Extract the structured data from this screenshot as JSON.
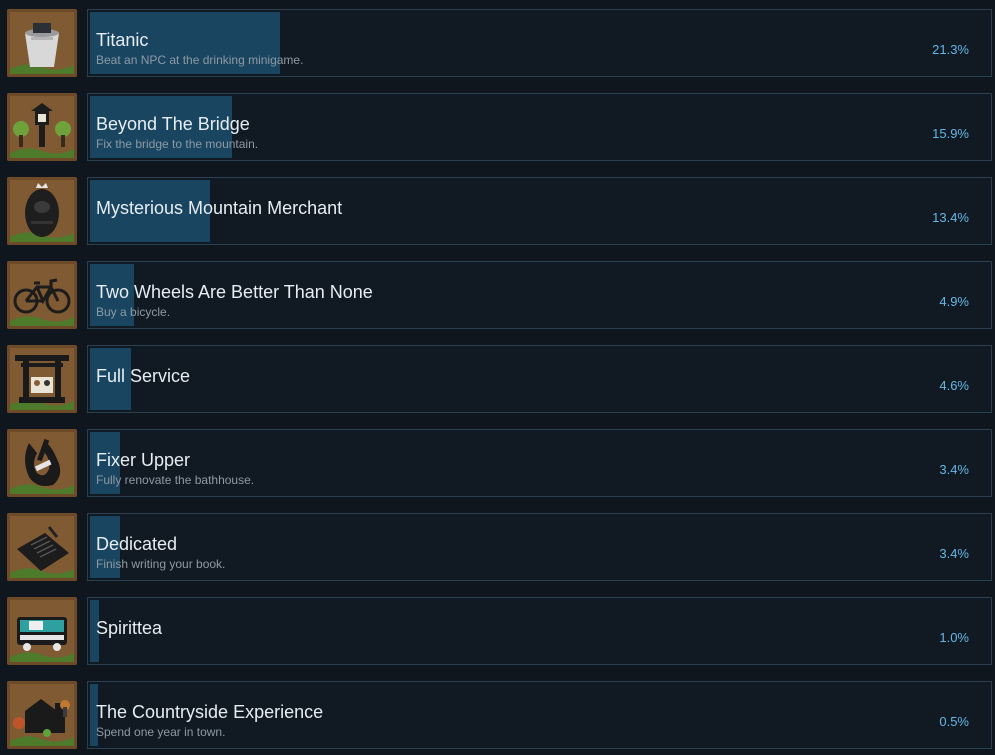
{
  "achievements": [
    {
      "title": "Titanic",
      "description": "Beat an NPC at the drinking minigame.",
      "percent_label": "21.3%",
      "percent": 21.3,
      "icon": "bucket-icon"
    },
    {
      "title": "Beyond The Bridge",
      "description": "Fix the bridge to the mountain.",
      "percent_label": "15.9%",
      "percent": 15.9,
      "icon": "lantern-trees-icon"
    },
    {
      "title": "Mysterious Mountain Merchant",
      "description": "",
      "percent_label": "13.4%",
      "percent": 13.4,
      "icon": "merchant-mask-icon"
    },
    {
      "title": "Two Wheels Are Better Than None",
      "description": "Buy a bicycle.",
      "percent_label": "4.9%",
      "percent": 4.9,
      "icon": "bicycle-icon"
    },
    {
      "title": "Full Service",
      "description": "",
      "percent_label": "4.6%",
      "percent": 4.6,
      "icon": "torii-shrine-icon"
    },
    {
      "title": "Fixer Upper",
      "description": "Fully renovate the bathhouse.",
      "percent_label": "3.4%",
      "percent": 3.4,
      "icon": "hammer-wrench-icon"
    },
    {
      "title": "Dedicated",
      "description": "Finish writing your book.",
      "percent_label": "3.4%",
      "percent": 3.4,
      "icon": "book-icon"
    },
    {
      "title": "Spirittea",
      "description": "",
      "percent_label": "1.0%",
      "percent": 1.0,
      "icon": "bus-icon"
    },
    {
      "title": "The Countryside Experience",
      "description": "Spend one year in town.",
      "percent_label": "0.5%",
      "percent": 0.5,
      "icon": "house-autumn-icon"
    }
  ]
}
